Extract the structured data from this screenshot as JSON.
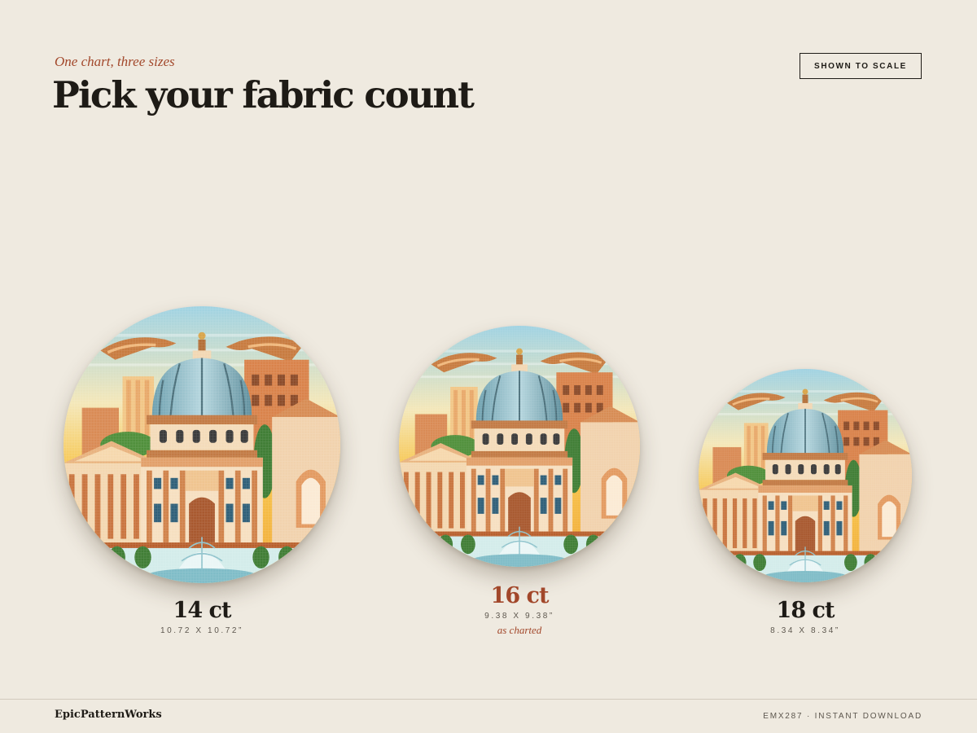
{
  "header": {
    "kicker": "One chart, three sizes",
    "title": "Pick your fabric count",
    "badge": "SHOWN TO SCALE"
  },
  "sizes": [
    {
      "count": "14 ct",
      "dimensions": "10.72 X 10.72”",
      "note": ""
    },
    {
      "count": "16 ct",
      "dimensions": "9.38 X 9.38”",
      "note": "as charted"
    },
    {
      "count": "18 ct",
      "dimensions": "8.34 X 8.34”",
      "note": ""
    }
  ],
  "footer": {
    "brand": "EpicPatternWorks",
    "sku": "EMX287 · INSTANT DOWNLOAD"
  },
  "colors": {
    "accent": "#a2472a",
    "ink": "#1e1b16",
    "background": "#efeae0"
  }
}
